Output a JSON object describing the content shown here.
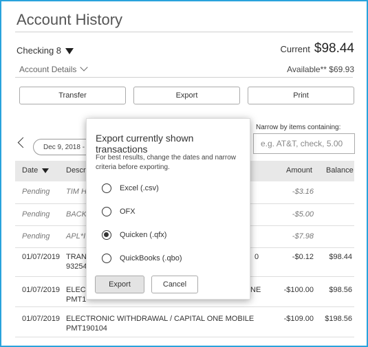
{
  "page": {
    "title": "Account History"
  },
  "account": {
    "selector": "Checking 8",
    "current_label": "Current",
    "current_amount": "$98.44",
    "details_label": "Account Details",
    "available_label": "Available**",
    "available_amount": "$69.93"
  },
  "toolbar": {
    "transfer": "Transfer",
    "export": "Export",
    "print": "Print"
  },
  "filter": {
    "date_range": "Dec 9, 2018 -",
    "narrow_label": "Narrow by items containing:",
    "narrow_placeholder": "e.g. AT&T, check, 5.00"
  },
  "table": {
    "headers": {
      "date": "Date",
      "description": "Descri",
      "amount": "Amount",
      "balance": "Balance"
    },
    "rows": [
      {
        "date": "Pending",
        "desc1": "TIM H",
        "desc2": "",
        "amount": "-$3.16",
        "balance": ""
      },
      {
        "date": "Pending",
        "desc1": "BACK",
        "desc2": "",
        "amount": "-$5.00",
        "balance": ""
      },
      {
        "date": "Pending",
        "desc1": "APL*I",
        "desc2": "",
        "amount": "-$7.98",
        "balance": ""
      },
      {
        "date": "01/07/2019",
        "desc1": "TRAN",
        "desc2": "93254",
        "extra": "0",
        "amount": "-$0.12",
        "balance": "$98.44"
      },
      {
        "date": "01/07/2019",
        "desc1": "ELEC",
        "desc2": "PMT1",
        "extra": "NE",
        "amount": "-$100.00",
        "balance": "$98.56"
      },
      {
        "date": "01/07/2019",
        "desc1": "ELECTRONIC WITHDRAWAL / CAPITAL ONE MOBILE",
        "desc2": "PMT190104",
        "amount": "-$109.00",
        "balance": "$198.56"
      }
    ]
  },
  "modal": {
    "title": "Export currently shown transactions",
    "description": "For best results, change the dates and narrow criteria before exporting.",
    "options": [
      "Excel (.csv)",
      "OFX",
      "Quicken (.qfx)",
      "QuickBooks (.qbo)"
    ],
    "selected": "Quicken (.qfx)",
    "export_button": "Export",
    "cancel_button": "Cancel"
  }
}
